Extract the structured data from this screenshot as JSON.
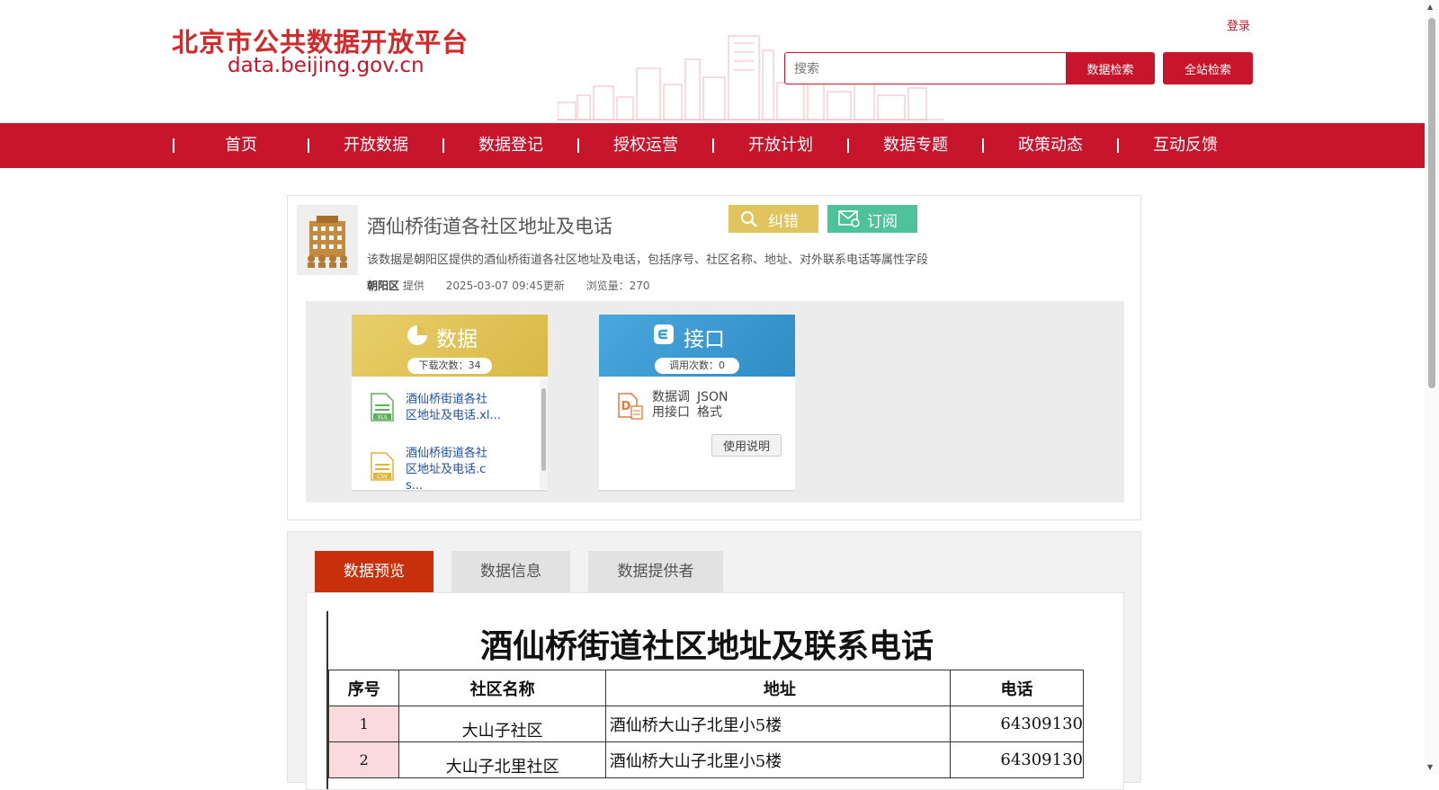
{
  "header": {
    "logo_cn": "北京市公共数据开放平台",
    "logo_en": "data.beijing.gov.cn",
    "login": "登录",
    "search_placeholder": "搜索",
    "data_search_btn": "数据检索",
    "site_search_btn": "全站检索"
  },
  "nav": {
    "items": [
      "首页",
      "开放数据",
      "数据登记",
      "授权运营",
      "开放计划",
      "数据专题",
      "政策动态",
      "互动反馈"
    ]
  },
  "dataset": {
    "title": "酒仙桥街道各社区地址及电话",
    "correct_btn": "纠错",
    "subscribe_btn": "订阅",
    "description": "该数据是朝阳区提供的酒仙桥街道各社区地址及电话，包括序号、社区名称、地址、对外联系电话等属性字段",
    "provider": "朝阳区",
    "provider_suffix": "提供",
    "updated": "2025-03-07 09:45更新",
    "views": "浏览量：270"
  },
  "resources": {
    "data": {
      "title": "数据",
      "count": "下载次数：34",
      "files": [
        {
          "icon": "xls-file-icon",
          "name_line1": "酒仙桥街道各社",
          "name_line2": "区地址及电话.xl..."
        },
        {
          "icon": "csv-file-icon",
          "name_line1": "酒仙桥街道各社",
          "name_line2": "区地址及电话.c",
          "name_line3": "s..."
        }
      ]
    },
    "api": {
      "title": "接口",
      "count": "调用次数：0",
      "label_line1": "数据调",
      "label_line2": "用接口",
      "format_line1": "JSON",
      "format_line2": "格式",
      "usage_btn": "使用说明"
    }
  },
  "tabs": [
    "数据预览",
    "数据信息",
    "数据提供者"
  ],
  "preview": {
    "title": "酒仙桥街道社区地址及联系电话",
    "columns": [
      "序号",
      "社区名称",
      "地址",
      "电话"
    ],
    "rows": [
      [
        "1",
        "大山子社区",
        "酒仙桥大山子北里小5楼",
        "64309130"
      ],
      [
        "2",
        "大山子北里社区",
        "酒仙桥大山子北里小5楼",
        "64309130"
      ]
    ]
  },
  "colors": {
    "brand_red": "#c7162b",
    "active_tab": "#c7300b",
    "correct_yellow": "#e2c45f",
    "subscribe_green": "#4fc19b",
    "api_blue": "#3a9bd5",
    "data_gold": "#e5c85a"
  }
}
